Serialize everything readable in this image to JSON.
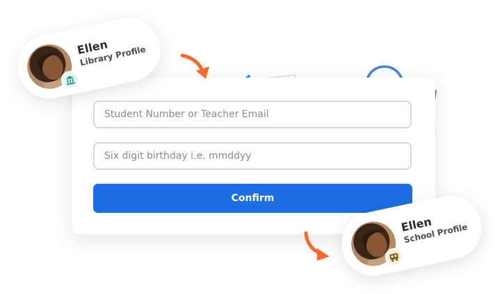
{
  "form": {
    "student_placeholder": "Student Number or Teacher Email",
    "birthday_placeholder": "Six digit birthday i.e. mmddyy",
    "confirm_label": "Confirm"
  },
  "profiles": {
    "library": {
      "name": "Ellen",
      "type": "Library Profile",
      "badge_icon": "library-icon"
    },
    "school": {
      "name": "Ellen",
      "type": "School Profile",
      "badge_icon": "school-bus-icon"
    }
  },
  "colors": {
    "primary": "#1d6ee0",
    "arrow": "#f26a2e",
    "deco_blue": "#3a86d9",
    "deco_pink": "#f07b95"
  }
}
